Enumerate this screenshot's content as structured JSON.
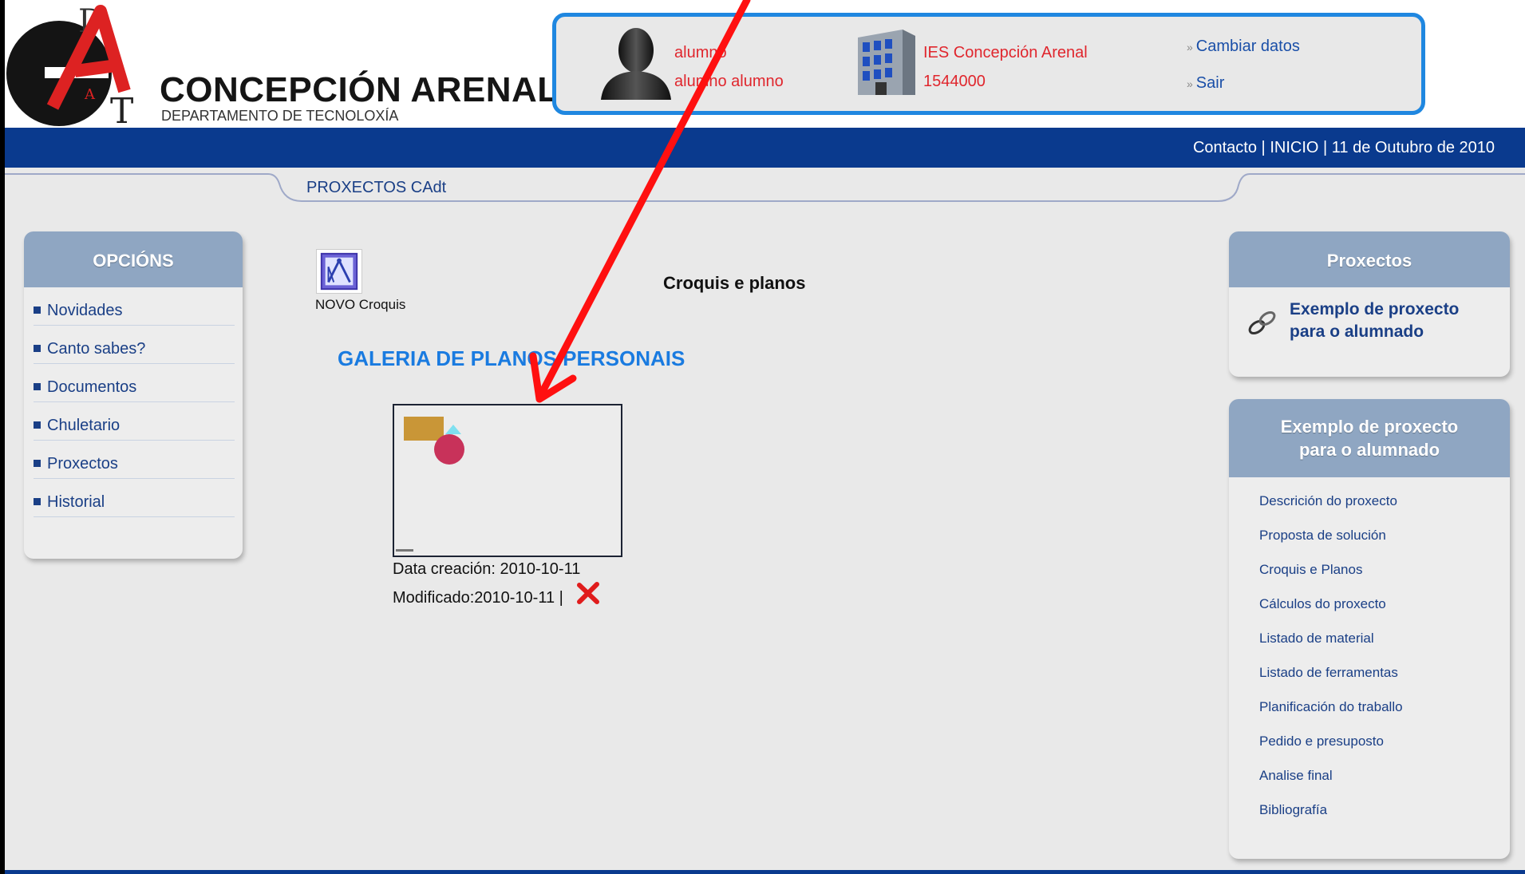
{
  "header": {
    "logo_letters": [
      "D",
      "A",
      "T"
    ],
    "logo_title": "CONCEPCIÓN  ARENAL",
    "logo_subtitle": "DEPARTAMENTO DE TECNOLOXÍA",
    "user_line1": "alumno",
    "user_line2": "alumno alumno",
    "school_name": "IES Concepción Arenal",
    "school_code": "1544000",
    "link_cambiar": "Cambiar datos",
    "link_sair": "Sair",
    "chevron": "»"
  },
  "bluebar": {
    "contacto": "Contacto",
    "inicio": "INICIO",
    "separator": " | ",
    "date": "11 de Outubro de 2010"
  },
  "tab": {
    "label": "PROXECTOS CAdt"
  },
  "left_panel": {
    "title": "OPCIÓNS",
    "items": [
      {
        "label": "Novidades"
      },
      {
        "label": "Canto sabes?"
      },
      {
        "label": "Documentos"
      },
      {
        "label": "Chuletario"
      },
      {
        "label": "Proxectos"
      },
      {
        "label": "Historial"
      }
    ]
  },
  "main": {
    "novo_label": "NOVO Croquis",
    "section_heading": "Croquis e planos",
    "gallery_title": "GALERIA DE PLANOS PERSONAIS",
    "created": "Data creación: 2010-10-11",
    "modified": "Modificado:2010-10-11 |"
  },
  "right_panel_1": {
    "title": "Proxectos",
    "link": "Exemplo de proxecto para o alumnado"
  },
  "right_panel_2": {
    "title_line1": "Exemplo de proxecto",
    "title_line2": "para o alumnado",
    "items": [
      {
        "label": "Descrición do proxecto"
      },
      {
        "label": "Proposta de solución"
      },
      {
        "label": "Croquis e Planos"
      },
      {
        "label": "Cálculos do proxecto"
      },
      {
        "label": "Listado de material"
      },
      {
        "label": "Listado de ferramentas"
      },
      {
        "label": "Planificación do traballo"
      },
      {
        "label": "Pedido e presuposto"
      },
      {
        "label": "Analise final"
      },
      {
        "label": "Bibliografía"
      }
    ]
  },
  "colors": {
    "accent_blue": "#0a3a8e",
    "panel_header": "#8fa6c2",
    "user_text_red": "#e0262d",
    "annotation_red": "#ff0000"
  }
}
